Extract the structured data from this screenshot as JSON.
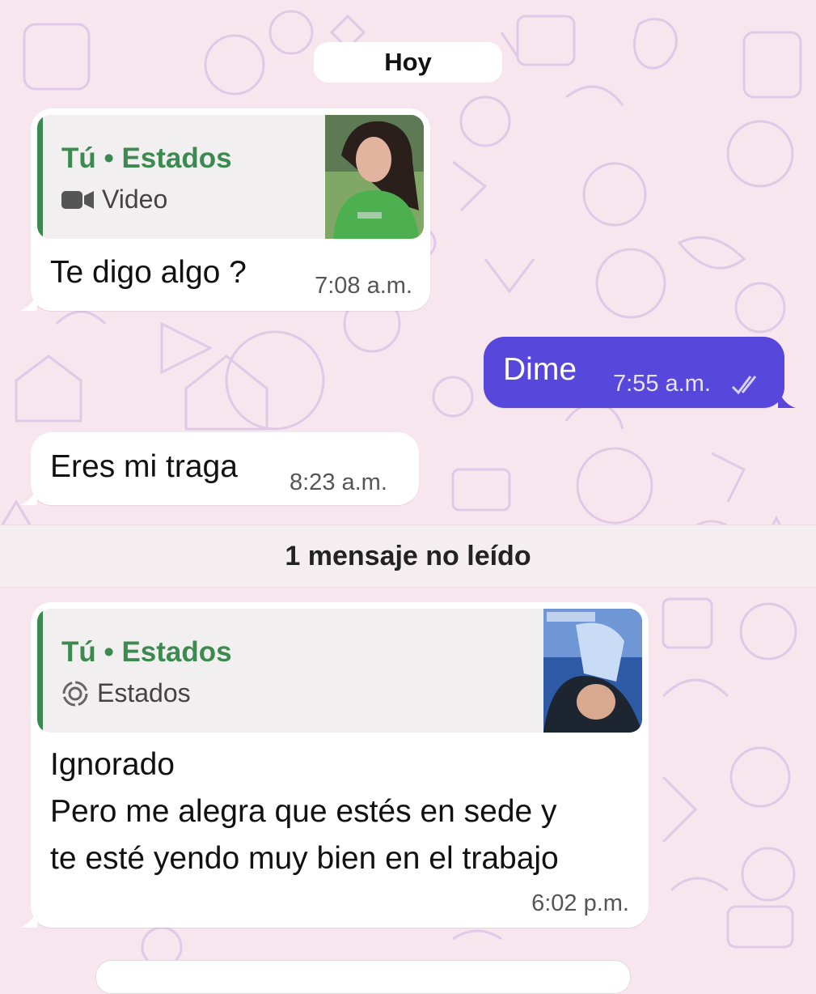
{
  "colors": {
    "background": "#f8e6ee",
    "incoming_bubble": "#ffffff",
    "outgoing_bubble": "#5847db",
    "quote_accent": "#3c8a4f"
  },
  "date_chip": "Hoy",
  "messages": [
    {
      "direction": "incoming",
      "quote": {
        "author": "Tú • Estados",
        "icon": "video-camera-icon",
        "label": "Video",
        "thumbnail": "status-video-thumbnail"
      },
      "text": "Te digo algo ?",
      "time": "7:08 a.m."
    },
    {
      "direction": "outgoing",
      "text": "Dime",
      "time": "7:55 a.m.",
      "status_icon": "double-check-icon"
    },
    {
      "direction": "incoming",
      "text": "Eres mi traga",
      "time": "8:23 a.m."
    },
    {
      "direction": "incoming",
      "quote": {
        "author": "Tú • Estados",
        "icon": "status-ring-icon",
        "label": "Estados",
        "thumbnail": "status-image-thumbnail"
      },
      "text_lines": [
        "Ignorado",
        "Pero me alegra que estés en sede y",
        "te esté yendo muy bien en el trabajo"
      ],
      "time": "6:02 p.m."
    }
  ],
  "unread_banner": "1 mensaje no leído"
}
